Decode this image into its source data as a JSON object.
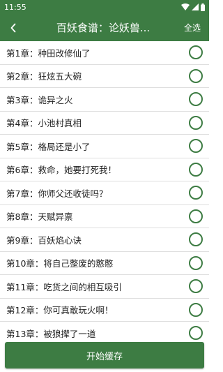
{
  "status_bar": {
    "time": "11:55"
  },
  "app_bar": {
    "title": "百妖食谱：论妖兽...",
    "select_all_label": "全选"
  },
  "chapters": [
    "第1章：种田改修仙了",
    "第2章：狂炫五大碗",
    "第3章：诡异之火",
    "第4章：小池村真相",
    "第5章：格局还是小了",
    "第6章：救命，她要打死我！",
    "第7章：你师父还收徒吗？",
    "第8章：天赋异禀",
    "第9章：百妖焰心诀",
    "第10章：将自己整废的憨憨",
    "第11章：吃货之间的相互吸引",
    "第12章：你可真敢玩火啊！",
    "第13章：被狼撵了一道"
  ],
  "footer": {
    "start_cache_label": "开始缓存"
  },
  "colors": {
    "primary": "#3d7c43",
    "divider": "#dedede",
    "text": "#222222"
  }
}
